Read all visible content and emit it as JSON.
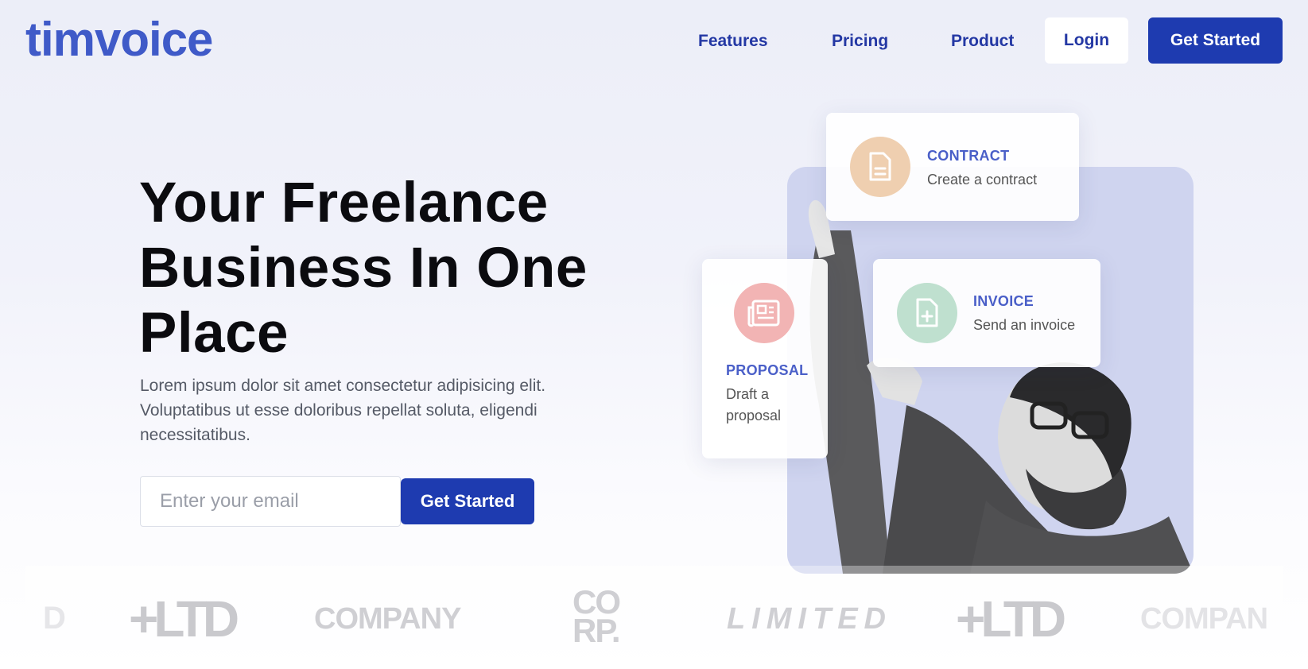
{
  "nav": {
    "logo": "timvoice",
    "links": [
      "Features",
      "Pricing",
      "Product"
    ],
    "login": "Login",
    "cta": "Get Started"
  },
  "hero": {
    "title": "Your Freelance Business In One Place",
    "subtitle": "Lorem ipsum dolor sit amet consectetur adipisicing elit. Voluptatibus ut esse doloribus repellat soluta, eligendi necessitatibus.",
    "email_placeholder": "Enter your email",
    "cta": "Get Started"
  },
  "cards": {
    "contract": {
      "title": "CONTRACT",
      "text": "Create a contract",
      "icon": "document-icon",
      "color": "#efcfb0"
    },
    "invoice": {
      "title": "INVOICE",
      "text": "Send an invoice",
      "icon": "document-plus-icon",
      "color": "#bfe0cf"
    },
    "proposal": {
      "title": "PROPOSAL",
      "text": "Draft a proposal",
      "icon": "newspaper-icon",
      "color": "#f2b4b4"
    }
  },
  "brands": [
    "D",
    "+LTD",
    "COMPANY",
    "CO RP.",
    "LIMITED",
    "+LTD",
    "COMPAN"
  ],
  "colors": {
    "primary": "#1e3bb0",
    "logo": "#3f5ac8",
    "link": "#2438a4"
  }
}
